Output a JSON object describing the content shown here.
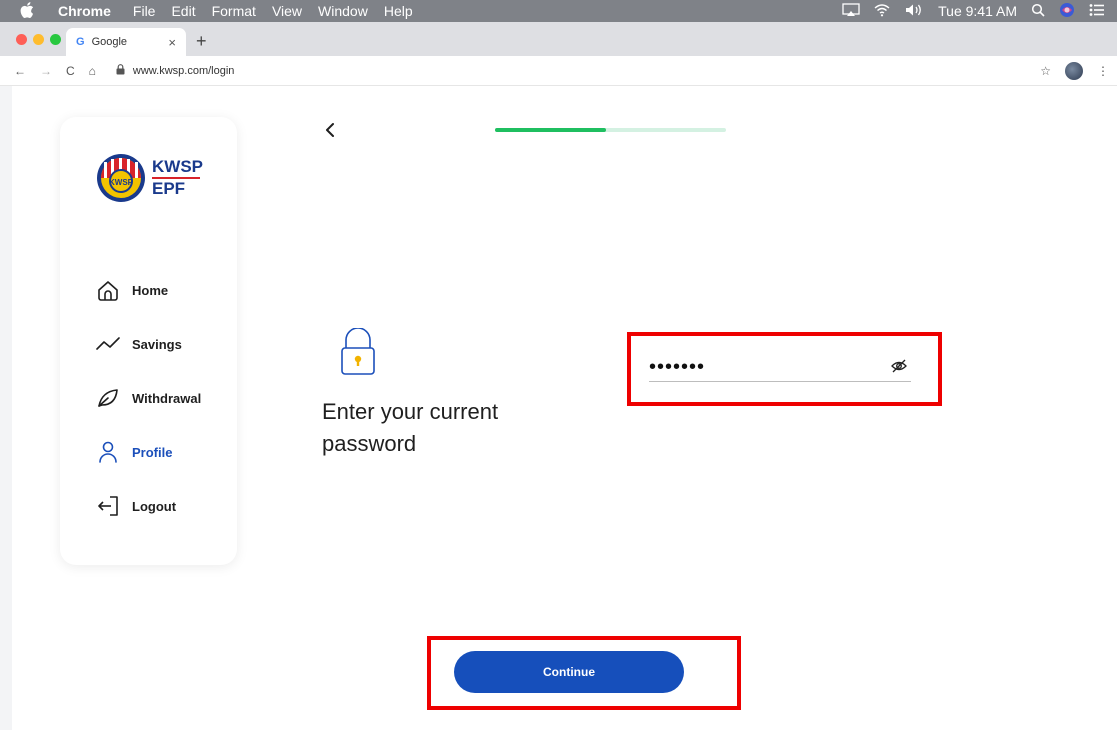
{
  "menubar": {
    "app": "Chrome",
    "items": [
      "File",
      "Edit",
      "Format",
      "View",
      "Window",
      "Help"
    ],
    "clock": "Tue 9:41 AM"
  },
  "browser": {
    "tab_title": "Google",
    "tab_favicon": "G",
    "url": "www.kwsp.com/login"
  },
  "brand": {
    "line1": "KWSP",
    "line2": "EPF",
    "emblem_text": "KWSP"
  },
  "sidebar": {
    "items": [
      {
        "label": "Home",
        "icon": "home-icon"
      },
      {
        "label": "Savings",
        "icon": "trend-icon"
      },
      {
        "label": "Withdrawal",
        "icon": "leaf-icon"
      },
      {
        "label": "Profile",
        "icon": "user-icon"
      },
      {
        "label": "Logout",
        "icon": "logout-icon"
      }
    ],
    "active": "Profile"
  },
  "progress": {
    "value": 0.48
  },
  "form": {
    "heading": "Enter your current password",
    "password_masked": "•••••••",
    "continue_label": "Continue"
  },
  "colors": {
    "primary": "#164fbb",
    "progress": "#1fbf60",
    "progress_track": "#d4f1e2",
    "highlight": "#ee0000"
  }
}
